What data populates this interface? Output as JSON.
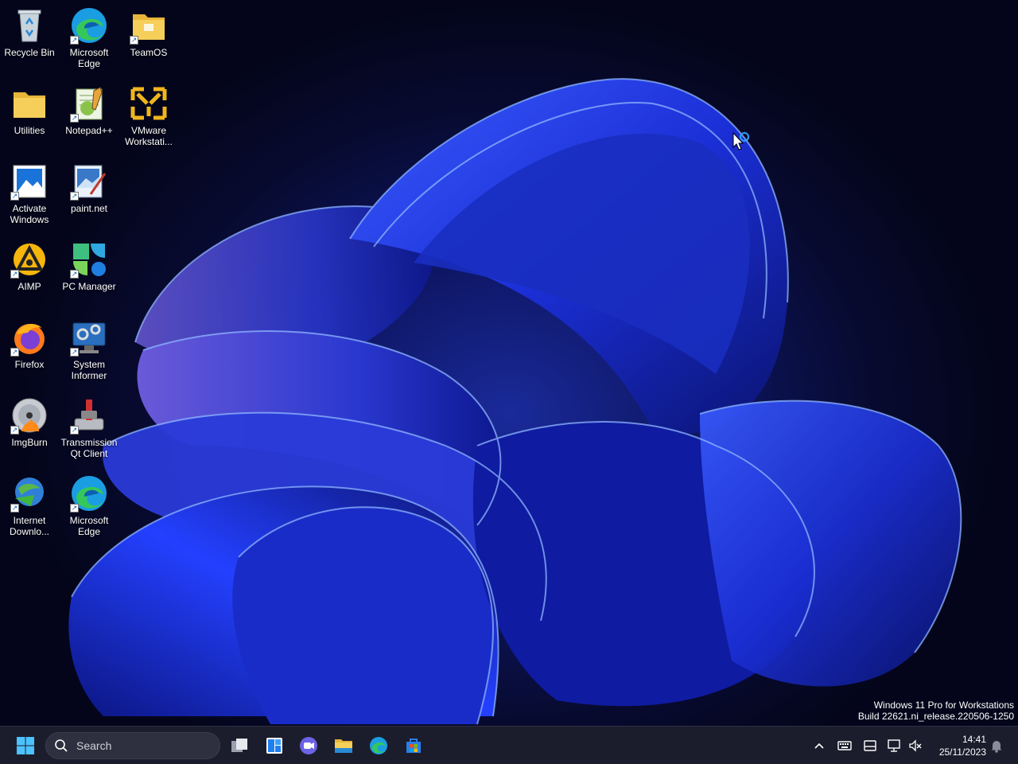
{
  "desktop": {
    "icons": [
      {
        "label": "Recycle Bin",
        "icon": "recycle-bin-icon",
        "shortcut": false
      },
      {
        "label": "Microsoft Edge",
        "icon": "edge-icon",
        "shortcut": true
      },
      {
        "label": "TeamOS",
        "icon": "folder-icon",
        "shortcut": true
      },
      {
        "label": "Utilities",
        "icon": "folder-icon",
        "shortcut": false
      },
      {
        "label": "Notepad++",
        "icon": "notepad-plus-plus-icon",
        "shortcut": true
      },
      {
        "label": "VMware Workstati...",
        "icon": "vmware-icon",
        "shortcut": false
      },
      {
        "label": "Activate Windows",
        "icon": "activate-windows-icon",
        "shortcut": true
      },
      {
        "label": "paint.net",
        "icon": "paint-net-icon",
        "shortcut": true
      },
      {
        "label": "AIMP",
        "icon": "aimp-icon",
        "shortcut": true
      },
      {
        "label": "PC Manager",
        "icon": "pc-manager-icon",
        "shortcut": true
      },
      {
        "label": "Firefox",
        "icon": "firefox-icon",
        "shortcut": true
      },
      {
        "label": "System Informer",
        "icon": "system-informer-icon",
        "shortcut": true
      },
      {
        "label": "ImgBurn",
        "icon": "imgburn-icon",
        "shortcut": true
      },
      {
        "label": "Transmission Qt Client",
        "icon": "transmission-icon",
        "shortcut": true
      },
      {
        "label": "Internet Downlo...",
        "icon": "internet-download-manager-icon",
        "shortcut": true
      },
      {
        "label": "Microsoft Edge",
        "icon": "edge-icon",
        "shortcut": true
      }
    ]
  },
  "watermark": {
    "line1": "Windows 11 Pro for Workstations",
    "line2": "Build 22621.ni_release.220506-1250"
  },
  "taskbar": {
    "search_placeholder": "Search",
    "pinned": [
      "start-icon",
      "task-view-icon",
      "widgets-icon",
      "teams-chat-icon",
      "file-explorer-icon",
      "edge-icon",
      "microsoft-store-icon"
    ],
    "tray": [
      "chevron-up-icon",
      "keyboard-icon",
      "ime-icon",
      "network-icon",
      "volume-muted-icon",
      "notification-bell-icon"
    ],
    "time": "14:41",
    "date": "25/11/2023"
  },
  "colors": {
    "taskbar_bg": "#1c1d2c",
    "wallpaper_accent": "#1e3cff",
    "folder_yellow": "#f4c542"
  }
}
